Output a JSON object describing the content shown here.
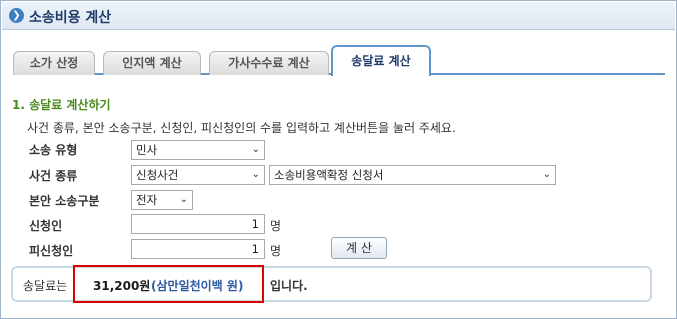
{
  "window": {
    "title": "소송비용 계산"
  },
  "tabs": [
    {
      "label": "소가 산정",
      "active": false
    },
    {
      "label": "인지액 계산",
      "active": false
    },
    {
      "label": "가사수수료 계산",
      "active": false
    },
    {
      "label": "송달료 계산",
      "active": true
    }
  ],
  "section": {
    "title": "1. 송달료 계산하기",
    "description": "사건 종류, 본안 소송구분, 신청인, 피신청인의 수를 입력하고 계산버튼을 눌러 주세요."
  },
  "form": {
    "lawsuit_type": {
      "label": "소송 유형",
      "value": "민사"
    },
    "case_type": {
      "label": "사건 종류",
      "value": "신청사건",
      "detail_value": "소송비용액확정 신청서"
    },
    "main_suit": {
      "label": "본안 소송구분",
      "value": "전자"
    },
    "applicant": {
      "label": "신청인",
      "value": "1",
      "unit": "명"
    },
    "respondent": {
      "label": "피신청인",
      "value": "1",
      "unit": "명"
    },
    "calculate_label": "계 산"
  },
  "result": {
    "prefix": "송달료는",
    "amount": "31,200원",
    "amount_words": "(삼만일천이백 원)",
    "suffix": "입니다."
  }
}
